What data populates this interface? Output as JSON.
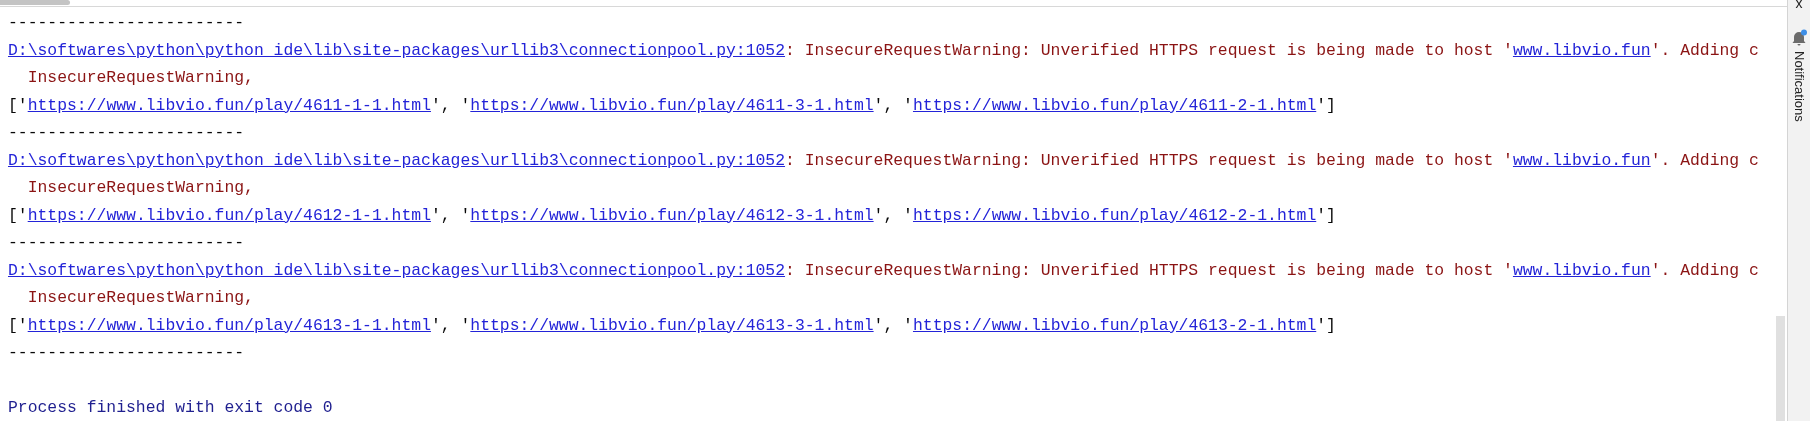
{
  "console": {
    "lines": [
      {
        "kind": "separator",
        "text": "------------------------"
      },
      {
        "kind": "warning",
        "path": "D:\\softwares\\python\\python_ide\\lib\\site-packages\\urllib3\\connectionpool.py:1052",
        "message_start": ": InsecureRequestWarning: Unverified HTTPS request is being made to host '",
        "host": "www.libvio.fun",
        "message_end": "'. Adding c"
      },
      {
        "kind": "continuation",
        "text": "  InsecureRequestWarning,"
      },
      {
        "kind": "url_list",
        "open": "['",
        "joiner": "', '",
        "close": "']",
        "urls": [
          "https://www.libvio.fun/play/4611-1-1.html",
          "https://www.libvio.fun/play/4611-3-1.html",
          "https://www.libvio.fun/play/4611-2-1.html"
        ]
      },
      {
        "kind": "separator",
        "text": "------------------------"
      },
      {
        "kind": "warning",
        "path": "D:\\softwares\\python\\python_ide\\lib\\site-packages\\urllib3\\connectionpool.py:1052",
        "message_start": ": InsecureRequestWarning: Unverified HTTPS request is being made to host '",
        "host": "www.libvio.fun",
        "message_end": "'. Adding c"
      },
      {
        "kind": "continuation",
        "text": "  InsecureRequestWarning,"
      },
      {
        "kind": "url_list",
        "open": "['",
        "joiner": "', '",
        "close": "']",
        "urls": [
          "https://www.libvio.fun/play/4612-1-1.html",
          "https://www.libvio.fun/play/4612-3-1.html",
          "https://www.libvio.fun/play/4612-2-1.html"
        ]
      },
      {
        "kind": "separator",
        "text": "------------------------"
      },
      {
        "kind": "warning",
        "path": "D:\\softwares\\python\\python_ide\\lib\\site-packages\\urllib3\\connectionpool.py:1052",
        "message_start": ": InsecureRequestWarning: Unverified HTTPS request is being made to host '",
        "host": "www.libvio.fun",
        "message_end": "'. Adding c"
      },
      {
        "kind": "continuation",
        "text": "  InsecureRequestWarning,"
      },
      {
        "kind": "url_list",
        "open": "['",
        "joiner": "', '",
        "close": "']",
        "urls": [
          "https://www.libvio.fun/play/4613-1-1.html",
          "https://www.libvio.fun/play/4613-3-1.html",
          "https://www.libvio.fun/play/4613-2-1.html"
        ]
      },
      {
        "kind": "separator",
        "text": "------------------------"
      },
      {
        "kind": "blank"
      },
      {
        "kind": "exit",
        "text": "Process finished with exit code 0"
      }
    ]
  },
  "side_strip": {
    "top_label": "x",
    "notifications": {
      "label": "Notifications",
      "unread": true
    }
  }
}
